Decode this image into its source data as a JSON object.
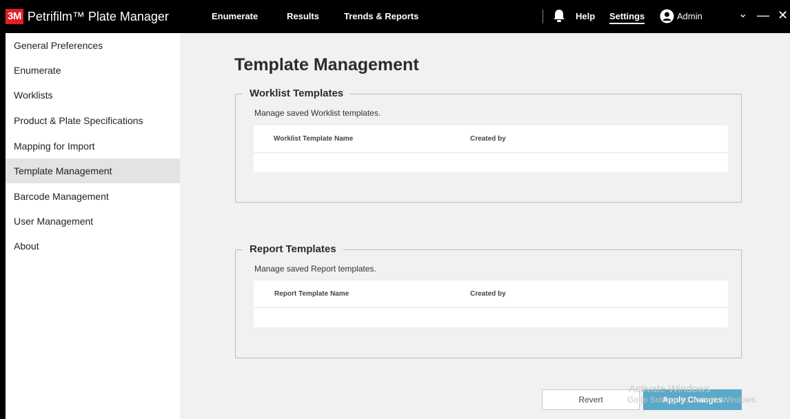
{
  "app": {
    "logo_text": "3M",
    "title": "Petrifilm™ Plate Manager"
  },
  "nav": {
    "enumerate": "Enumerate",
    "results": "Results",
    "trends": "Trends & Reports",
    "help": "Help",
    "settings": "Settings",
    "admin": "Admin"
  },
  "window_controls": {
    "dropdown": "⌄",
    "minimize": "—",
    "close": "✕"
  },
  "sidebar": {
    "items": [
      {
        "label": "General Preferences"
      },
      {
        "label": "Enumerate"
      },
      {
        "label": "Worklists"
      },
      {
        "label": "Product & Plate Specifications"
      },
      {
        "label": "Mapping for Import"
      },
      {
        "label": "Template Management",
        "active": true
      },
      {
        "label": "Barcode Management"
      },
      {
        "label": "User Management"
      },
      {
        "label": "About"
      }
    ]
  },
  "main": {
    "title": "Template Management",
    "worklist": {
      "legend": "Worklist Templates",
      "description": "Manage saved Worklist templates.",
      "columns": [
        "Worklist Template Name",
        "Created by"
      ]
    },
    "report": {
      "legend": "Report Templates",
      "description": "Manage saved Report templates.",
      "columns": [
        "Report Template Name",
        "Created by"
      ]
    },
    "buttons": {
      "revert": "Revert",
      "apply": "Apply Changes"
    }
  },
  "watermark": {
    "line1": "Activate Windows",
    "line2": "Go to Settings to activate Windows."
  },
  "colors": {
    "topbar": "#000000",
    "brand_red": "#e31f26",
    "apply_button": "#5aa9c8",
    "active_sidebar": "#e3e3e3"
  }
}
